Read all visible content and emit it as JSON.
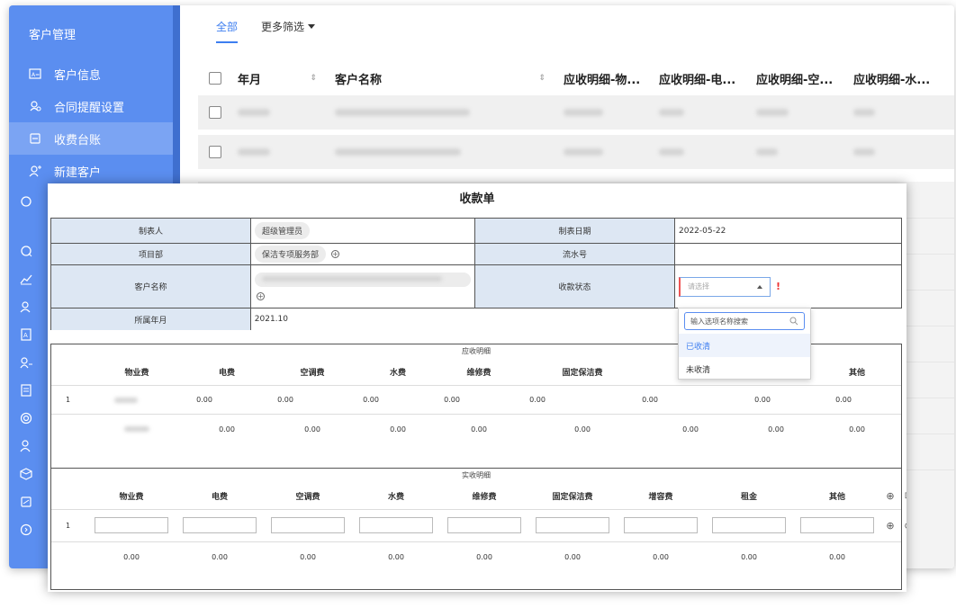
{
  "sidebar": {
    "title": "客户管理",
    "items": [
      {
        "label": "客户信息",
        "icon": "id-card-icon",
        "active": false
      },
      {
        "label": "合同提醒设置",
        "icon": "bell-user-icon",
        "active": false
      },
      {
        "label": "收费台账",
        "icon": "ledger-icon",
        "active": true
      },
      {
        "label": "新建客户",
        "icon": "add-user-icon",
        "active": false
      }
    ],
    "icon_only": [
      "chat-icon",
      "chat-icon",
      "chart-line-icon",
      "user-group-icon",
      "document-a-icon",
      "user-list-icon",
      "calendar-doc-icon",
      "target-icon",
      "users-icon",
      "cube-icon",
      "edit-doc-icon",
      "circle-arrow-icon"
    ]
  },
  "filters": {
    "all": "全部",
    "more": "更多筛选"
  },
  "back_table": {
    "columns": [
      "年月",
      "客户名称",
      "应收明细-物...",
      "应收明细-电...",
      "应收明细-空...",
      "应收明细-水..."
    ]
  },
  "dialog": {
    "title": "收款单",
    "fields": {
      "maker_label": "制表人",
      "maker_value": "超级管理员",
      "date_label": "制表日期",
      "date_value": "2022-05-22",
      "dept_label": "项目部",
      "dept_value": "保洁专项服务部",
      "serial_label": "流水号",
      "serial_value": "",
      "customer_label": "客户名称",
      "status_label": "收款状态",
      "status_placeholder": "请选择",
      "month_label": "所属年月",
      "month_value": "2021.10"
    },
    "receivable": {
      "title": "应收明细",
      "headers": [
        "物业费",
        "电费",
        "空调费",
        "水费",
        "维修费",
        "固定保洁费",
        "",
        "",
        "其他"
      ],
      "row1": {
        "index": "1",
        "values": [
          "0.00",
          "0.00",
          "0.00",
          "0.00",
          "0.00",
          "0.00",
          "0.00",
          "0.00"
        ]
      },
      "row2": {
        "values": [
          "0.00",
          "0.00",
          "0.00",
          "0.00",
          "0.00",
          "0.00",
          "0.00",
          "0.00"
        ]
      }
    },
    "actual": {
      "title": "实收明细",
      "headers": [
        "物业费",
        "电费",
        "空调费",
        "水费",
        "维修费",
        "固定保洁费",
        "增容费",
        "租金",
        "其他"
      ],
      "row_index": "1",
      "totals": [
        "0.00",
        "0.00",
        "0.00",
        "0.00",
        "0.00",
        "0.00",
        "0.00",
        "0.00",
        "0.00"
      ]
    }
  },
  "dropdown": {
    "search_placeholder": "输入选项名称搜索",
    "options": [
      "已收清",
      "未收清"
    ]
  }
}
